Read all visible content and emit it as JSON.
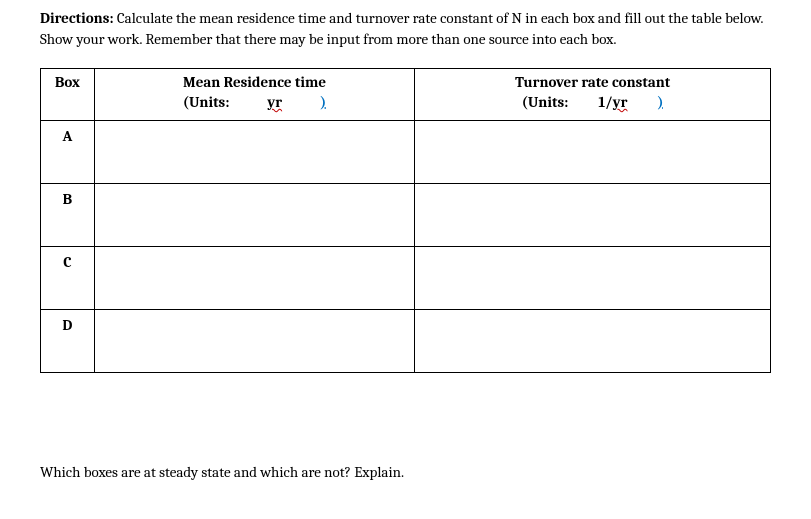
{
  "directions": {
    "label": "Directions:",
    "text": " Calculate the mean residence time and turnover rate constant of N in each box and fill out the table below.  Show your work.  Remember that there may be input from more than one source into each box."
  },
  "table": {
    "headers": {
      "box": "Box",
      "mrt": "Mean Residence time",
      "trc": "Turnover rate constant",
      "units_label": "(Units:",
      "mrt_unit": "yr",
      "trc_unit": "1/yr",
      "close_paren": ")"
    },
    "rows": [
      {
        "label": "A",
        "mrt": "",
        "trc": ""
      },
      {
        "label": "B",
        "mrt": "",
        "trc": ""
      },
      {
        "label": "C",
        "mrt": "",
        "trc": ""
      },
      {
        "label": "D",
        "mrt": "",
        "trc": ""
      }
    ]
  },
  "question": "Which boxes are at steady state and which are not? Explain."
}
